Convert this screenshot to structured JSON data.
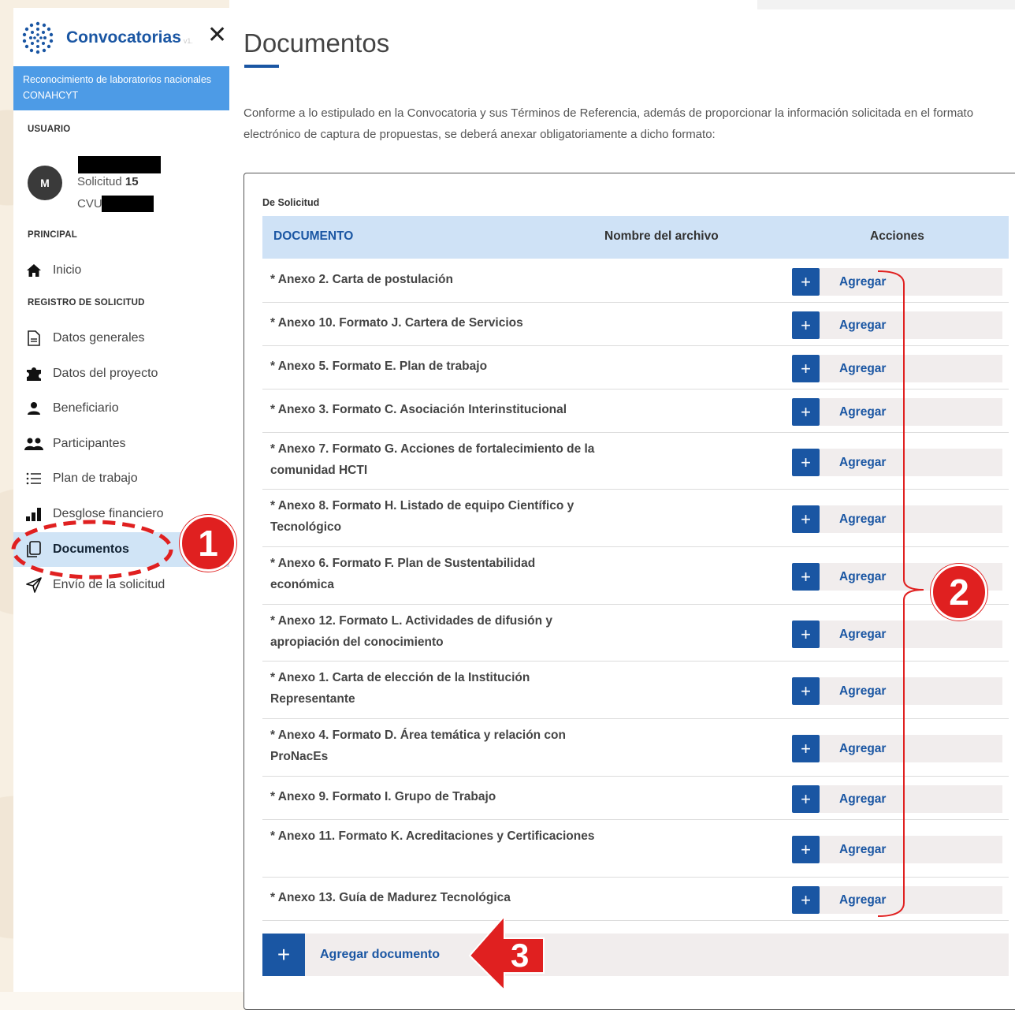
{
  "sidebar": {
    "brand": "Convocatorias",
    "version": "v1.",
    "convocatoria": "Reconocimiento de laboratorios nacionales CONAHCYT",
    "usuario_label": "USUARIO",
    "avatar_initial": "M",
    "solicitud_label": "Solicitud",
    "solicitud_num": "15",
    "cvu_label": "CVU",
    "principal_label": "PRINCIPAL",
    "inicio": "Inicio",
    "registro_label": "REGISTRO DE SOLICITUD",
    "items": [
      {
        "label": "Datos generales",
        "icon": "document-icon"
      },
      {
        "label": "Datos del proyecto",
        "icon": "puzzle-icon"
      },
      {
        "label": "Beneficiario",
        "icon": "user-icon"
      },
      {
        "label": "Participantes",
        "icon": "users-icon"
      },
      {
        "label": "Plan de trabajo",
        "icon": "list-icon"
      },
      {
        "label": "Desglose financiero",
        "icon": "bar-chart-icon"
      },
      {
        "label": "Documentos",
        "icon": "copy-icon",
        "active": true
      },
      {
        "label": "Envío de la solicitud",
        "icon": "send-icon"
      }
    ]
  },
  "main": {
    "title": "Documentos",
    "intro": "Conforme a lo estipulado en la Convocatoria y sus Términos de Referencia, además de proporcionar la información solicitada en el formato electrónico de captura de propuestas, se deberá anexar obligatoriamente a dicho formato:",
    "section_label": "De Solicitud",
    "columns": {
      "documento": "DOCUMENTO",
      "nombre": "Nombre del archivo",
      "acciones": "Acciones"
    },
    "rows": [
      {
        "label": "* Anexo 2. Carta de postulación",
        "action": "Agregar"
      },
      {
        "label": "* Anexo 10. Formato J. Cartera de Servicios",
        "action": "Agregar"
      },
      {
        "label": "* Anexo 5. Formato E. Plan de trabajo",
        "action": "Agregar"
      },
      {
        "label": "* Anexo 3. Formato C. Asociación Interinstitucional",
        "action": "Agregar"
      },
      {
        "label": "* Anexo 7. Formato G. Acciones de fortalecimiento de la comunidad HCTI",
        "action": "Agregar"
      },
      {
        "label": "* Anexo 8. Formato H. Listado de equipo Científico y Tecnológico",
        "action": "Agregar"
      },
      {
        "label": "* Anexo 6. Formato F. Plan de Sustentabilidad económica",
        "action": "Agregar"
      },
      {
        "label": "* Anexo 12. Formato L. Actividades de difusión y apropiación del conocimiento",
        "action": "Agregar"
      },
      {
        "label": "* Anexo 1. Carta de elección de la Institución Representante",
        "action": "Agregar"
      },
      {
        "label": "* Anexo 4. Formato D. Área temática y relación con ProNacEs",
        "action": "Agregar"
      },
      {
        "label": "* Anexo 9. Formato I. Grupo de Trabajo",
        "action": "Agregar"
      },
      {
        "label": "* Anexo 11. Formato K. Acreditaciones y Certificaciones",
        "action": "Agregar"
      },
      {
        "label": "* Anexo 13. Guía de Madurez Tecnológica",
        "action": "Agregar"
      }
    ],
    "add_document": "Agregar documento",
    "add_symbol": "+"
  },
  "annotations": {
    "one": "1",
    "two": "2",
    "three": "3",
    "color": "#e02020"
  },
  "colors": {
    "primary": "#1a56a3",
    "banner": "#4d9be6",
    "header": "#cfe2f6",
    "active_nav": "#d0e4f6"
  }
}
